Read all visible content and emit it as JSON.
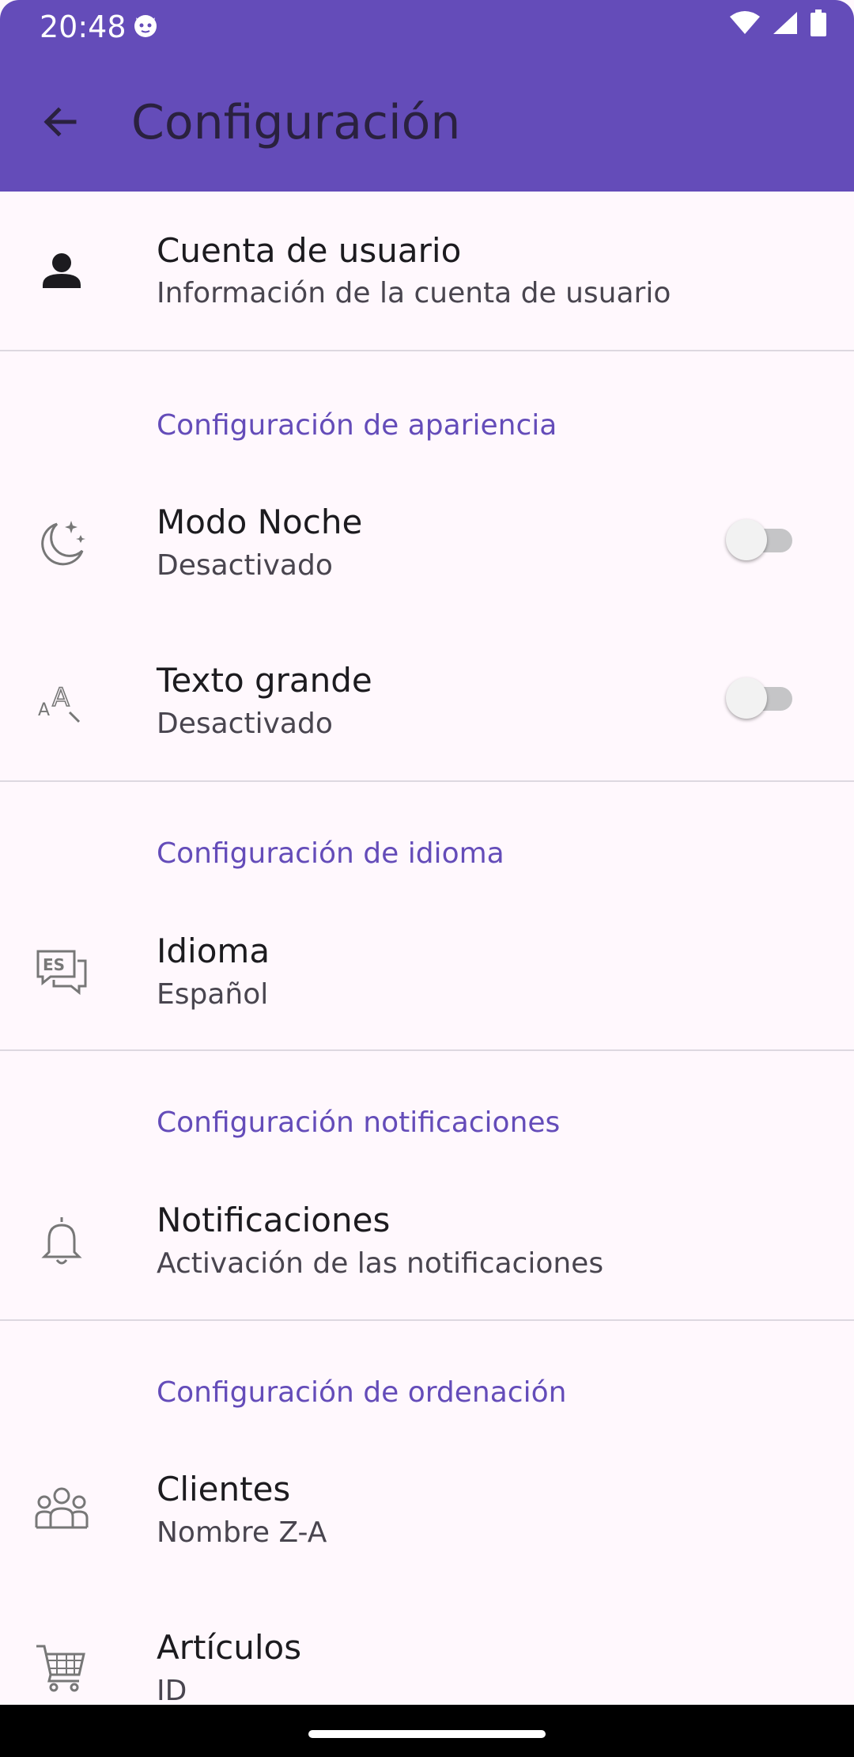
{
  "status_bar": {
    "time": "20:48"
  },
  "app_bar": {
    "title": "Configuración"
  },
  "account": {
    "title": "Cuenta de usuario",
    "subtitle": "Información de la cuenta de usuario"
  },
  "appearance": {
    "header": "Configuración de apariencia",
    "night_mode": {
      "title": "Modo Noche",
      "subtitle": "Desactivado",
      "enabled": false
    },
    "large_text": {
      "title": "Texto grande",
      "subtitle": "Desactivado",
      "enabled": false
    }
  },
  "language": {
    "header": "Configuración de idioma",
    "item": {
      "title": "Idioma",
      "subtitle": "Español",
      "icon_text": "ES"
    }
  },
  "notifications": {
    "header": "Configuración notificaciones",
    "item": {
      "title": "Notificaciones",
      "subtitle": "Activación de las notificaciones"
    }
  },
  "sorting": {
    "header": "Configuración de ordenación",
    "clients": {
      "title": "Clientes",
      "subtitle": "Nombre Z-A"
    },
    "articles": {
      "title": "Artículos",
      "subtitle": "ID"
    }
  },
  "colors": {
    "primary": "#644CB9",
    "background": "#FFF8FD",
    "switch_off_track": "#C5C5C7"
  },
  "icons": [
    "arrow-back-icon",
    "person-icon",
    "night-mode-icon",
    "text-size-icon",
    "language-icon",
    "bell-icon",
    "group-icon",
    "cart-icon"
  ]
}
